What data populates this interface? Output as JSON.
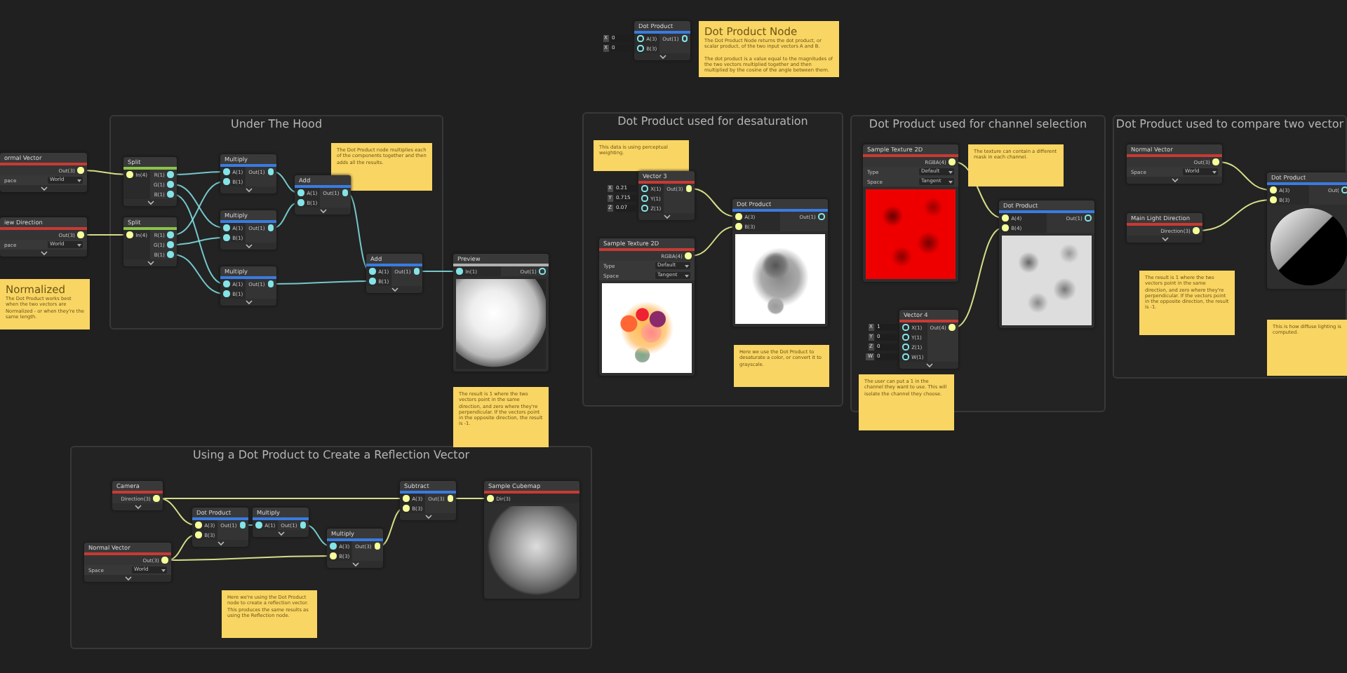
{
  "groups": [
    {
      "title": "Under The Hood"
    },
    {
      "title": "Dot Product used for desaturation"
    },
    {
      "title": "Dot Product used for channel selection"
    },
    {
      "title": "Dot Product used to compare two vector"
    },
    {
      "title": "Using a Dot Product to Create a Reflection Vector"
    }
  ],
  "nodes": [
    {
      "title": "ormal Vector",
      "color": "#c83a34",
      "outputs": [
        {
          "label": "Out(3)",
          "color": "#f6ff9a"
        }
      ],
      "options": [
        {
          "label": "pace",
          "value": "World"
        }
      ]
    },
    {
      "title": "iew Direction",
      "color": "#c83a34",
      "outputs": [
        {
          "label": "Out(3)",
          "color": "#f6ff9a"
        }
      ],
      "options": [
        {
          "label": "pace",
          "value": "World"
        }
      ]
    },
    {
      "title": "Split",
      "color": "#8bc34a",
      "inputs": [
        {
          "label": "In(4)",
          "color": "#f6ff9a"
        }
      ],
      "outputs": [
        {
          "label": "R(1)",
          "color": "#84e4e7"
        },
        {
          "label": "G(1)",
          "color": "#84e4e7"
        },
        {
          "label": "B(1)",
          "color": "#84e4e7"
        }
      ]
    },
    {
      "title": "Split",
      "color": "#8bc34a",
      "inputs": [
        {
          "label": "In(4)",
          "color": "#f6ff9a"
        }
      ],
      "outputs": [
        {
          "label": "R(1)",
          "color": "#84e4e7"
        },
        {
          "label": "G(1)",
          "color": "#84e4e7"
        },
        {
          "label": "B(1)",
          "color": "#84e4e7"
        }
      ]
    },
    {
      "title": "Multiply",
      "color": "#3a7be0",
      "inputs": [
        {
          "label": "A(1)",
          "color": "#84e4e7"
        },
        {
          "label": "B(1)",
          "color": "#84e4e7"
        }
      ],
      "outputs": [
        {
          "label": "Out(1)",
          "color": "#84e4e7"
        }
      ]
    },
    {
      "title": "Multiply",
      "color": "#3a7be0",
      "inputs": [
        {
          "label": "A(1)",
          "color": "#84e4e7"
        },
        {
          "label": "B(1)",
          "color": "#84e4e7"
        }
      ],
      "outputs": [
        {
          "label": "Out(1)",
          "color": "#84e4e7"
        }
      ]
    },
    {
      "title": "Multiply",
      "color": "#3a7be0",
      "inputs": [
        {
          "label": "A(1)",
          "color": "#84e4e7"
        },
        {
          "label": "B(1)",
          "color": "#84e4e7"
        }
      ],
      "outputs": [
        {
          "label": "Out(1)",
          "color": "#84e4e7"
        }
      ]
    },
    {
      "title": "Add",
      "color": "#3a7be0",
      "inputs": [
        {
          "label": "A(1)",
          "color": "#84e4e7"
        },
        {
          "label": "B(1)",
          "color": "#84e4e7"
        }
      ],
      "outputs": [
        {
          "label": "Out(1)",
          "color": "#84e4e7"
        }
      ]
    },
    {
      "title": "Add",
      "color": "#3a7be0",
      "inputs": [
        {
          "label": "A(1)",
          "color": "#84e4e7"
        },
        {
          "label": "B(1)",
          "color": "#84e4e7"
        }
      ],
      "outputs": [
        {
          "label": "Out(1)",
          "color": "#84e4e7"
        }
      ]
    },
    {
      "title": "Preview",
      "color": "#b0b0b0",
      "inputs": [
        {
          "label": "In(1)",
          "color": "#84e4e7"
        }
      ],
      "outputs": [
        {
          "label": "Out(1)",
          "color": "#84e4e7"
        }
      ],
      "preview": {
        "kind": "sphere"
      }
    },
    {
      "title": "Dot Product",
      "color": "#3a7be0",
      "inputs": [
        {
          "label": "A(3)",
          "color": "#84e4e7"
        },
        {
          "label": "B(3)",
          "color": "#84e4e7"
        }
      ],
      "outputs": [
        {
          "label": "Out(1)",
          "color": "#84e4e7"
        }
      ],
      "fields": [
        {
          "axis": "X",
          "value": "0"
        },
        {
          "axis": "X",
          "value": "0"
        }
      ]
    },
    {
      "title": "Vector 3",
      "color": "#c83a34",
      "inputs": [
        {
          "label": "X(1)",
          "color": "#84e4e7"
        },
        {
          "label": "Y(1)",
          "color": "#84e4e7"
        },
        {
          "label": "Z(1)",
          "color": "#84e4e7"
        }
      ],
      "outputs": [
        {
          "label": "Out(3)",
          "color": "#f6ff9a"
        }
      ],
      "fields": [
        {
          "axis": "X",
          "value": "0.21"
        },
        {
          "axis": "Y",
          "value": "0.715"
        },
        {
          "axis": "Z",
          "value": "0.07"
        }
      ]
    },
    {
      "title": "Sample Texture 2D",
      "color": "#c83a34",
      "outputs": [
        {
          "label": "RGBA(4)",
          "color": "#f6ff9a"
        }
      ],
      "options": [
        {
          "label": "Type",
          "value": "Default"
        },
        {
          "label": "Space",
          "value": "Tangent"
        }
      ],
      "preview": {
        "kind": "flowers"
      }
    },
    {
      "title": "Dot Product",
      "color": "#3a7be0",
      "inputs": [
        {
          "label": "A(3)",
          "color": "#f6ff9a"
        },
        {
          "label": "B(3)",
          "color": "#f6ff9a"
        }
      ],
      "outputs": [
        {
          "label": "Out(1)",
          "color": "#84e4e7"
        }
      ],
      "preview": {
        "kind": "grayscale"
      }
    },
    {
      "title": "Sample Texture 2D",
      "color": "#c83a34",
      "outputs": [
        {
          "label": "RGBA(4)",
          "color": "#f6ff9a"
        }
      ],
      "options": [
        {
          "label": "Type",
          "value": "Default"
        },
        {
          "label": "Space",
          "value": "Tangent"
        }
      ],
      "preview": {
        "kind": "red-noise"
      }
    },
    {
      "title": "Dot Product",
      "color": "#3a7be0",
      "inputs": [
        {
          "label": "A(4)",
          "color": "#f6ff9a"
        },
        {
          "label": "B(4)",
          "color": "#f6ff9a"
        }
      ],
      "outputs": [
        {
          "label": "Out(1)",
          "color": "#84e4e7"
        }
      ],
      "preview": {
        "kind": "gray-noise"
      }
    },
    {
      "title": "Vector 4",
      "color": "#c83a34",
      "inputs": [
        {
          "label": "X(1)",
          "color": "#84e4e7"
        },
        {
          "label": "Y(1)",
          "color": "#84e4e7"
        },
        {
          "label": "Z(1)",
          "color": "#84e4e7"
        },
        {
          "label": "W(1)",
          "color": "#84e4e7"
        }
      ],
      "outputs": [
        {
          "label": "Out(4)",
          "color": "#f6ff9a"
        }
      ],
      "fields": [
        {
          "axis": "X",
          "value": "1"
        },
        {
          "axis": "Y",
          "value": "0"
        },
        {
          "axis": "Z",
          "value": "0"
        },
        {
          "axis": "W",
          "value": "0"
        }
      ]
    },
    {
      "title": "Normal Vector",
      "color": "#c83a34",
      "outputs": [
        {
          "label": "Out(3)",
          "color": "#f6ff9a"
        }
      ],
      "options": [
        {
          "label": "Space",
          "value": "World"
        }
      ]
    },
    {
      "title": "Main Light Direction",
      "color": "#c83a34",
      "outputs": [
        {
          "label": "Direction(3)",
          "color": "#f6ff9a"
        }
      ]
    },
    {
      "title": "Dot Product",
      "color": "#3a7be0",
      "inputs": [
        {
          "label": "A(3)",
          "color": "#f6ff9a"
        },
        {
          "label": "B(3)",
          "color": "#f6ff9a"
        }
      ],
      "outputs": [
        {
          "label": "Out(",
          "color": "#84e4e7"
        }
      ],
      "preview": {
        "kind": "half-lit-sphere"
      }
    },
    {
      "title": "Camera",
      "color": "#c83a34",
      "outputs": [
        {
          "label": "Direction(3)",
          "color": "#f6ff9a"
        }
      ]
    },
    {
      "title": "Normal Vector",
      "color": "#c83a34",
      "outputs": [
        {
          "label": "Out(3)",
          "color": "#f6ff9a"
        }
      ],
      "options": [
        {
          "label": "Space",
          "value": "World"
        }
      ]
    },
    {
      "title": "Dot Product",
      "color": "#3a7be0",
      "inputs": [
        {
          "label": "A(3)",
          "color": "#f6ff9a"
        },
        {
          "label": "B(3)",
          "color": "#f6ff9a"
        }
      ],
      "outputs": [
        {
          "label": "Out(1)",
          "color": "#84e4e7"
        }
      ]
    },
    {
      "title": "Multiply",
      "color": "#3a7be0",
      "inputs": [
        {
          "label": "A(1)",
          "color": "#84e4e7"
        }
      ],
      "outputs": [
        {
          "label": "Out(1)",
          "color": "#84e4e7"
        }
      ]
    },
    {
      "title": "Multiply",
      "color": "#3a7be0",
      "inputs": [
        {
          "label": "A(3)",
          "color": "#84e4e7"
        },
        {
          "label": "B(3)",
          "color": "#f6ff9a"
        }
      ],
      "outputs": [
        {
          "label": "Out(3)",
          "color": "#f6ff9a"
        }
      ]
    },
    {
      "title": "Subtract",
      "color": "#3a7be0",
      "inputs": [
        {
          "label": "A(3)",
          "color": "#f6ff9a"
        },
        {
          "label": "B(3)",
          "color": "#f6ff9a"
        }
      ],
      "outputs": [
        {
          "label": "Out(3)",
          "color": "#f6ff9a"
        }
      ]
    },
    {
      "title": "Sample Cubemap",
      "color": "#c83a34",
      "inputs": [
        {
          "label": "Dir(3)",
          "color": "#f6ff9a"
        }
      ],
      "preview": {
        "kind": "cubemap"
      }
    }
  ],
  "notes": [
    {
      "title": "Dot Product Node",
      "paragraphs": [
        "The Dot Product Node returns the dot product, or scalar product, of the two input vectors A and B.",
        "The dot product is a value equal to the magnitudes of the two vectors multiplied together and then multiplied by the cosine of the angle between them."
      ]
    },
    {
      "paragraphs": [
        "The Dot Product node multiplies each of the components together and then adds all the results."
      ]
    },
    {
      "title": "Normalized",
      "paragraphs": [
        "The Dot Product works best when the two vectors are Normalized - or when they're the same length."
      ]
    },
    {
      "paragraphs": [
        "This data is using perceptual weighting."
      ]
    },
    {
      "paragraphs": [
        "Here we use the Dot Product to desaturate a color, or convert it to grayscale."
      ]
    },
    {
      "paragraphs": [
        "The result is 1 where the two vectors point in the same direction, and zero where they're perpendicular. If the vectors point in the opposite direction, the result is -1."
      ]
    },
    {
      "paragraphs": [
        "The texture can contain a different mask in each channel."
      ]
    },
    {
      "paragraphs": [
        "The user can put a 1 in the channel they want to use. This will isolate the channel they choose."
      ]
    },
    {
      "paragraphs": [
        "The result is 1 where the two vectors point in the same direction, and zero where they're perpendicular. If the vectors point in the opposite direction, the result is -1."
      ]
    },
    {
      "paragraphs": [
        "This is how diffuse lighting is computed."
      ]
    },
    {
      "paragraphs": [
        "Here we're using the Dot Product node to create a reflection vector. This produces the same results as using the Reflection node."
      ]
    }
  ]
}
